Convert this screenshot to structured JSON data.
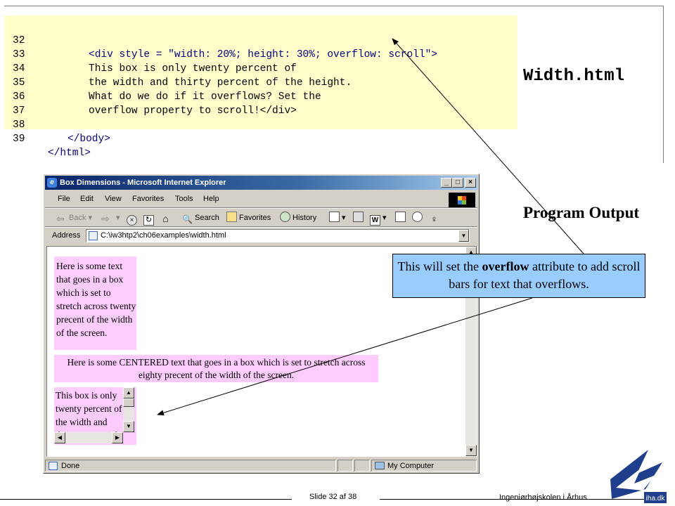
{
  "code": {
    "lines": [
      {
        "num": "32",
        "text": "<div style = \"width: 20%; height: 30%; overflow: scroll\">"
      },
      {
        "num": "33",
        "text": "This box is only twenty percent of"
      },
      {
        "num": "34",
        "text": "the width and thirty percent of the height."
      },
      {
        "num": "35",
        "text": "What do we do if it overflows? Set the"
      },
      {
        "num": "36",
        "text": "overflow property to scroll!</div>"
      },
      {
        "num": "37",
        "text": ""
      },
      {
        "num": "38",
        "text": "</body>"
      },
      {
        "num": "39",
        "text": "</html>"
      }
    ]
  },
  "file_title": "Width.html",
  "program_output_label": "Program Output",
  "callout": {
    "prefix": "This will set the ",
    "bold": "overflow",
    "suffix": " attribute to add scroll bars for text that overflows."
  },
  "browser": {
    "title": "Box Dimensions - Microsoft Internet Explorer",
    "menu": [
      "File",
      "Edit",
      "View",
      "Favorites",
      "Tools",
      "Help"
    ],
    "toolbar": {
      "back": "Back",
      "search": "Search",
      "favorites": "Favorites",
      "history": "History"
    },
    "address_label": "Address",
    "address_value": "C:\\iw3htp2\\ch06examples\\width.html",
    "page": {
      "box1": "Here is some text that goes in a box which is set to stretch across twenty precent of the width of the screen.",
      "box2": "Here is some CENTERED text that goes in a box which is set to stretch across eighty precent of the width of the screen.",
      "box3": "This box is only twenty percent of the width and thirty percent of the height."
    },
    "status_text": "Done",
    "zone_text": "My Computer"
  },
  "footer": {
    "slide": "Slide 32 af  38",
    "institution": "Ingeniørhøjskolen i Århus",
    "logo_text": "iha.dk"
  }
}
